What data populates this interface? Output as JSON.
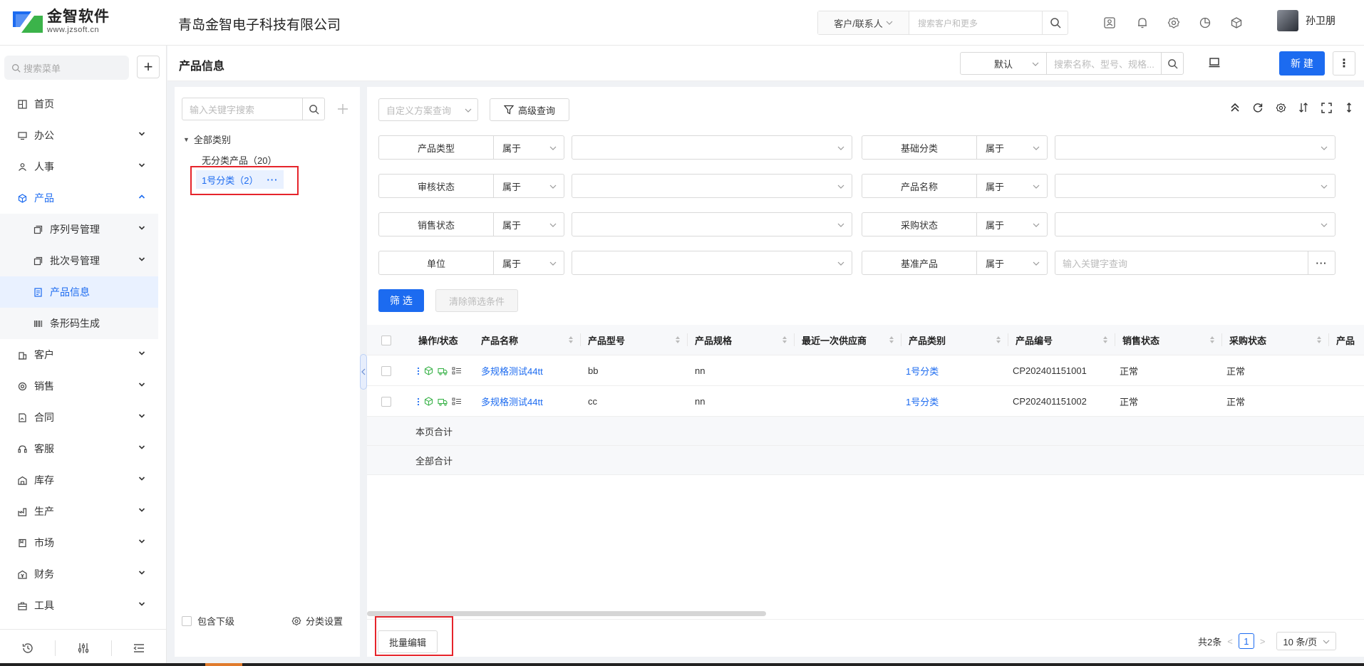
{
  "app": {
    "logo_cn": "金智软件",
    "logo_en": "www.jzsoft.cn",
    "company": "青岛金智电子科技有限公司",
    "brand_color": "#1c6bf0",
    "highlight_color": "#e6242b"
  },
  "header": {
    "search_scope": "客户/联系人",
    "search_placeholder": "搜索客户和更多",
    "user_name": "孙卫朋",
    "icons": [
      "contact-card-icon",
      "bell-icon",
      "gear-icon",
      "pie-chart-icon",
      "cube-icon"
    ]
  },
  "sidebar": {
    "search_placeholder": "搜索菜单",
    "plus": "+",
    "items": [
      {
        "label": "首页",
        "icon": "grid-icon"
      },
      {
        "label": "办公",
        "icon": "monitor-icon"
      },
      {
        "label": "人事",
        "icon": "people-icon"
      },
      {
        "label": "产品",
        "icon": "cube-icon"
      },
      {
        "label": "客户",
        "icon": "building-icon"
      },
      {
        "label": "销售",
        "icon": "target-icon"
      },
      {
        "label": "合同",
        "icon": "contract-icon"
      },
      {
        "label": "客服",
        "icon": "headset-icon"
      },
      {
        "label": "库存",
        "icon": "warehouse-icon"
      },
      {
        "label": "生产",
        "icon": "factory-icon"
      },
      {
        "label": "市场",
        "icon": "book-icon"
      },
      {
        "label": "财务",
        "icon": "finance-icon"
      },
      {
        "label": "工具",
        "icon": "toolbox-icon"
      }
    ],
    "subitems": [
      {
        "label": "序列号管理"
      },
      {
        "label": "批次号管理"
      },
      {
        "label": "产品信息"
      },
      {
        "label": "条形码生成"
      }
    ]
  },
  "titlebar": {
    "title": "产品信息",
    "view": "默认",
    "search_placeholder": "搜索名称、型号、规格...",
    "new_label": "新 建",
    "more": "⋮"
  },
  "categories": {
    "search_placeholder": "输入关键字搜索",
    "root": "全部类别",
    "nodes": [
      {
        "label": "无分类产品（20）"
      },
      {
        "label": "1号分类（2）"
      }
    ],
    "dots": "···",
    "include_sub": "包含下级",
    "settings": "分类设置"
  },
  "filters": {
    "scheme_placeholder": "自定义方案查询",
    "advanced": "高级查询",
    "op": "属于",
    "keyword_placeholder": "输入关键字查询",
    "more": "···",
    "rows": [
      {
        "left": "产品类型",
        "right": "基础分类"
      },
      {
        "left": "审核状态",
        "right": "产品名称"
      },
      {
        "left": "销售状态",
        "right": "采购状态"
      },
      {
        "left": "单位",
        "right": "基准产品"
      }
    ],
    "filter_label": "筛 选",
    "clear_label": "清除筛选条件"
  },
  "table": {
    "columns": [
      "操作/状态",
      "产品名称",
      "产品型号",
      "产品规格",
      "最近一次供应商",
      "产品类别",
      "产品编号",
      "销售状态",
      "采购状态",
      "产品"
    ],
    "rows": [
      {
        "name": "多规格测试44tt",
        "model": "bb",
        "spec": "nn",
        "supplier": "",
        "category": "1号分类",
        "code": "CP202401151001",
        "sale": "正常",
        "purchase": "正常"
      },
      {
        "name": "多规格测试44tt",
        "model": "cc",
        "spec": "nn",
        "supplier": "",
        "category": "1号分类",
        "code": "CP202401151002",
        "sale": "正常",
        "purchase": "正常"
      }
    ],
    "page_total": "本页合计",
    "all_total": "全部合计"
  },
  "footer": {
    "batch_edit": "批量编辑",
    "total": "共2条",
    "page": "1",
    "page_size": "10 条/页"
  }
}
